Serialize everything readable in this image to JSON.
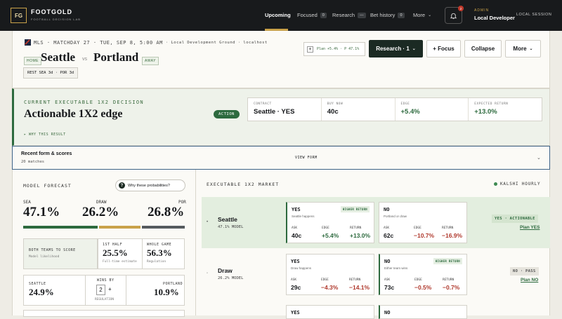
{
  "brand": {
    "logo": "FG",
    "name": "FOOTGOLD",
    "sub": "FOOTBALL DECISION LAB"
  },
  "nav": [
    {
      "label": "Upcoming"
    },
    {
      "label": "Focused",
      "badge": "0"
    },
    {
      "label": "Research",
      "badge": "—"
    },
    {
      "label": "Bet history",
      "badge": "0"
    },
    {
      "label": "More"
    }
  ],
  "notif_count": "2",
  "user": {
    "role": "ADMIN",
    "name": "Local Developer",
    "session": "LOCAL SESSION"
  },
  "match": {
    "line": "MLS · MATCHDAY 27 · TUE, SEP 8, 5:00 AM",
    "venue": "· Local Development Ground · localhost",
    "home": "Seattle",
    "vs": "vs",
    "away": "Portland",
    "home_tag": "HOME",
    "away_tag": "AWAY",
    "rest": "REST  SEA 3d · POR 3d"
  },
  "plan": {
    "text": "Plan +5.4% · P 47.1%",
    "plus": "+"
  },
  "buttons": {
    "research": "Research · 1",
    "focus": "+ Focus",
    "collapse": "Collapse",
    "more": "More"
  },
  "decision": {
    "label": "CURRENT EXECUTABLE 1X2 DECISION",
    "title": "Actionable 1X2 edge",
    "action": "ACTION",
    "why": "▸ WHY THIS RESULT",
    "metrics": [
      {
        "label": "CONTRACT",
        "value": "Seattle · YES"
      },
      {
        "label": "BUY NOW",
        "value": "40c"
      },
      {
        "label": "EDGE",
        "value": "+5.4%"
      },
      {
        "label": "EXPECTED RETURN",
        "value": "+13.0%"
      }
    ]
  },
  "recent": {
    "title": "Recent form & scores",
    "sub": "20 matches",
    "view": "VIEW FORM"
  },
  "forecast": {
    "label": "MODEL FORECAST",
    "why": "Why these probabilities?",
    "sea_label": "SEA",
    "sea": "47.1%",
    "draw_label": "DRAW",
    "draw": "26.2%",
    "por_label": "POR",
    "por": "26.8%",
    "bar_fracs": [
      0.471,
      0.262,
      0.268
    ],
    "bts_label": "BOTH TEAMS TO SCORE",
    "bts_sub": "Model likelihood",
    "half_label": "1ST HALF",
    "half": "25.5%",
    "half_sub": "Full-time estimate",
    "whole_label": "WHOLE GAME",
    "whole": "56.3%",
    "whole_sub": "Regulation",
    "sea2_label": "SEATTLE",
    "sea2": "24.9%",
    "wins_label": "WINS BY",
    "wins_val": "2",
    "wins_plus": "+",
    "wins_sub": "REGULATION",
    "por2_label": "PORTLAND",
    "por2": "10.9%"
  },
  "market": {
    "label": "EXECUTABLE 1X2 MARKET",
    "source": "KALSHI HOURLY",
    "rows": [
      {
        "team": "Seattle",
        "model": "47.1% MODEL",
        "status": "YES · ACTIONABLE",
        "plan": "Plan YES",
        "yes": {
          "side": "YES",
          "desc": "Seattle happens",
          "pill": "HIGHER RETURN",
          "ask": "40c",
          "edge": "+5.4%",
          "ret": "+13.0%"
        },
        "no": {
          "side": "NO",
          "desc": "Portland or draw",
          "ask": "62c",
          "edge": "−10.7%",
          "ret": "−16.9%"
        }
      },
      {
        "team": "Draw",
        "model": "26.2% MODEL",
        "status": "NO · PASS",
        "plan": "Plan NO",
        "yes": {
          "side": "YES",
          "desc": "Draw happens",
          "ask": "29c",
          "edge": "−4.3%",
          "ret": "−14.1%"
        },
        "no": {
          "side": "NO",
          "desc": "Either team wins",
          "pill": "HIGHER RETURN",
          "ask": "73c",
          "edge": "−0.5%",
          "ret": "−0.7%"
        }
      }
    ],
    "third_yes": "YES",
    "third_no": "NO",
    "ask_lbl": "ASK",
    "edge_lbl": "EDGE",
    "ret_lbl": "RETURN"
  }
}
